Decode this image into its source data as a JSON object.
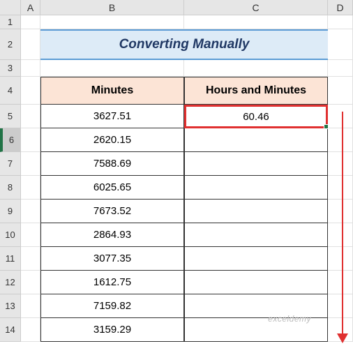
{
  "columns": [
    "",
    "A",
    "B",
    "C",
    "D"
  ],
  "rows": [
    "1",
    "2",
    "3",
    "4",
    "5",
    "6",
    "7",
    "8",
    "9",
    "10",
    "11",
    "12",
    "13",
    "14"
  ],
  "selected_row": "6",
  "title": "Converting Manually",
  "headers": {
    "col_b": "Minutes",
    "col_c": "Hours and Minutes"
  },
  "data": {
    "minutes": [
      "3627.51",
      "2620.15",
      "7588.69",
      "6025.65",
      "7673.52",
      "2864.93",
      "3077.35",
      "1612.75",
      "7159.82",
      "3159.29"
    ],
    "hours": [
      "60.46",
      "",
      "",
      "",
      "",
      "",
      "",
      "",
      "",
      ""
    ]
  },
  "watermark": "exceldemy"
}
